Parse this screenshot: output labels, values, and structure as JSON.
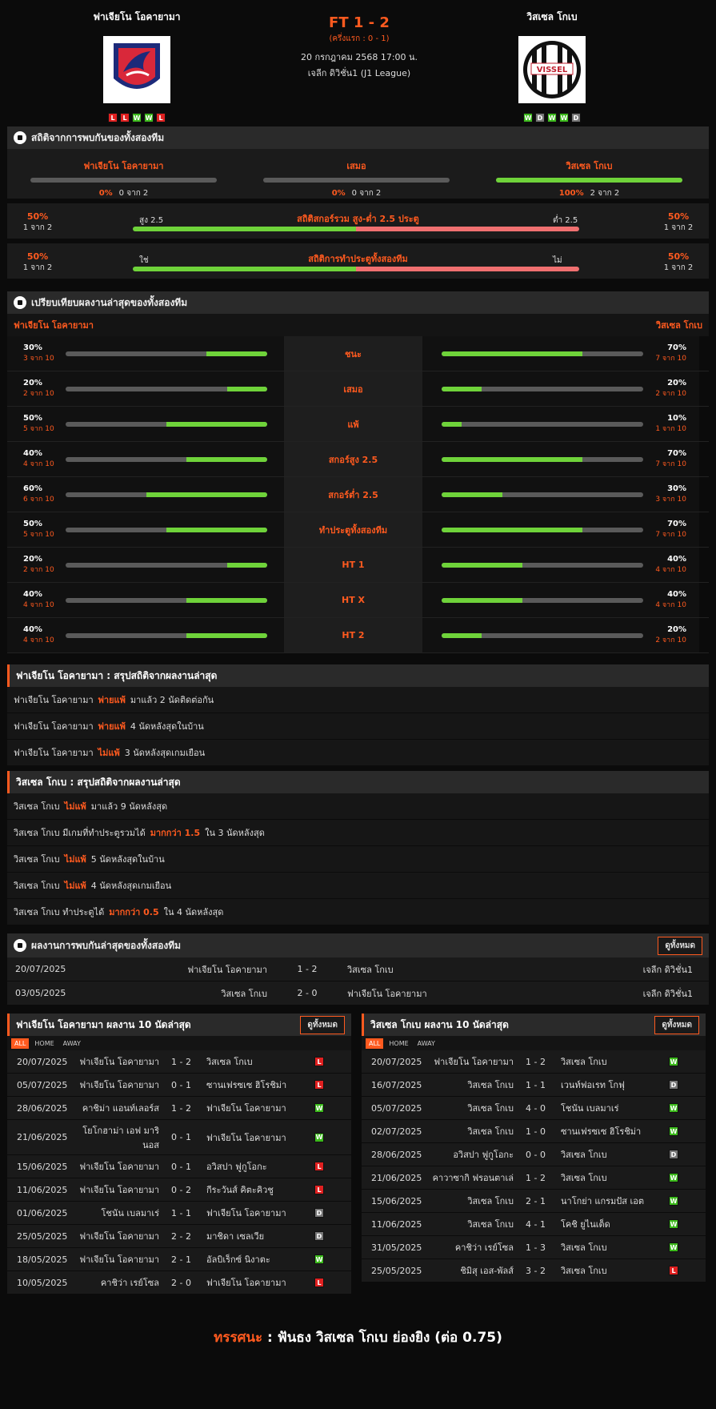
{
  "header": {
    "home": "ฟาเจียโน โอคายามา",
    "away": "วิสเซล โกเบ",
    "score": "FT 1 - 2",
    "half": "(ครึ่งแรก : 0 - 1)",
    "date": "20 กรกฎาคม 2568 17:00 น.",
    "league": "เจลีก ดิวิชั่น1 (J1 League)",
    "home_form": [
      "L",
      "L",
      "W",
      "W",
      "L"
    ],
    "away_form": [
      "W",
      "D",
      "W",
      "W",
      "D"
    ],
    "away_logo_text": "VISSEL"
  },
  "h2h": {
    "title": "สถิติจากการพบกันของทั้งสองทีม",
    "cols": [
      {
        "name": "ฟาเจียโน โอคายามา",
        "pct": "0%",
        "of": "0 จาก 2",
        "value": 0
      },
      {
        "name": "เสมอ",
        "pct": "0%",
        "of": "0 จาก 2",
        "value": 0
      },
      {
        "name": "วิสเซล โกเบ",
        "pct": "100%",
        "of": "2 จาก 2",
        "value": 100
      }
    ],
    "ou": {
      "title": "สถิติสกอร์รวม สูง-ต่ำ 2.5 ประตู",
      "left_label": "สูง 2.5",
      "right_label": "ต่ำ 2.5",
      "left_pct": "50%",
      "left_of": "1 จาก 2",
      "right_pct": "50%",
      "right_of": "1 จาก 2",
      "value": 50
    },
    "btts": {
      "title": "สถิติการทำประตูทั้งสองทีม",
      "left_label": "ใช่",
      "right_label": "ไม่",
      "left_pct": "50%",
      "left_of": "1 จาก 2",
      "right_pct": "50%",
      "right_of": "1 จาก 2",
      "value": 50
    }
  },
  "compare": {
    "title": "เปรียบเทียบผลงานล่าสุดของทั้งสองทีม",
    "home": "ฟาเจียโน โอคายามา",
    "away": "วิสเซล โกเบ",
    "rows": [
      {
        "label": "ชนะ",
        "hp": "30%",
        "hof": "3 จาก 10",
        "hv": 30,
        "ap": "70%",
        "aof": "7 จาก 10",
        "av": 70
      },
      {
        "label": "เสมอ",
        "hp": "20%",
        "hof": "2 จาก 10",
        "hv": 20,
        "ap": "20%",
        "aof": "2 จาก 10",
        "av": 20
      },
      {
        "label": "แพ้",
        "hp": "50%",
        "hof": "5 จาก 10",
        "hv": 50,
        "ap": "10%",
        "aof": "1 จาก 10",
        "av": 10
      },
      {
        "label": "สกอร์สูง 2.5",
        "hp": "40%",
        "hof": "4 จาก 10",
        "hv": 40,
        "ap": "70%",
        "aof": "7 จาก 10",
        "av": 70
      },
      {
        "label": "สกอร์ต่ำ 2.5",
        "hp": "60%",
        "hof": "6 จาก 10",
        "hv": 60,
        "ap": "30%",
        "aof": "3 จาก 10",
        "av": 30
      },
      {
        "label": "ทำประตูทั้งสองทีม",
        "hp": "50%",
        "hof": "5 จาก 10",
        "hv": 50,
        "ap": "70%",
        "aof": "7 จาก 10",
        "av": 70
      },
      {
        "label": "HT 1",
        "hp": "20%",
        "hof": "2 จาก 10",
        "hv": 20,
        "ap": "40%",
        "aof": "4 จาก 10",
        "av": 40
      },
      {
        "label": "HT X",
        "hp": "40%",
        "hof": "4 จาก 10",
        "hv": 40,
        "ap": "40%",
        "aof": "4 จาก 10",
        "av": 40
      },
      {
        "label": "HT 2",
        "hp": "40%",
        "hof": "4 จาก 10",
        "hv": 40,
        "ap": "20%",
        "aof": "2 จาก 10",
        "av": 20
      }
    ]
  },
  "home_summary": {
    "title": "ฟาเจียโน โอคายามา : สรุปสถิติจากผลงานล่าสุด",
    "rows": [
      {
        "pre": "ฟาเจียโน โอคายามา",
        "hl": "พ่ายแพ้",
        "post": "มาแล้ว 2 นัดติดต่อกัน"
      },
      {
        "pre": "ฟาเจียโน โอคายามา",
        "hl": "พ่ายแพ้",
        "post": "4 นัดหลังสุดในบ้าน"
      },
      {
        "pre": "ฟาเจียโน โอคายามา",
        "hl": "ไม่แพ้",
        "post": "3 นัดหลังสุดเกมเยือน"
      }
    ]
  },
  "away_summary": {
    "title": "วิสเซล โกเบ : สรุปสถิติจากผลงานล่าสุด",
    "rows": [
      {
        "pre": "วิสเซล โกเบ",
        "hl": "ไม่แพ้",
        "post": "มาแล้ว 9 นัดหลังสุด"
      },
      {
        "pre": "วิสเซล โกเบ มีเกมที่ทำประตูรวมได้",
        "hl": "มากกว่า 1.5",
        "post": "ใน 3 นัดหลังสุด"
      },
      {
        "pre": "วิสเซล โกเบ",
        "hl": "ไม่แพ้",
        "post": "5 นัดหลังสุดในบ้าน"
      },
      {
        "pre": "วิสเซล โกเบ",
        "hl": "ไม่แพ้",
        "post": "4 นัดหลังสุดเกมเยือน"
      },
      {
        "pre": "วิสเซล โกเบ ทำประตูได้",
        "hl": "มากกว่า 0.5",
        "post": "ใน 4 นัดหลังสุด"
      }
    ]
  },
  "recent_h2h": {
    "title": "ผลงานการพบกันล่าสุดของทั้งสองทีม",
    "see_all": "ดูทั้งหมด",
    "rows": [
      {
        "date": "20/07/2025",
        "home": "ฟาเจียโน โอคายามา",
        "score": "1 - 2",
        "away": "วิสเซล โกเบ",
        "league": "เจลีก ดิวิชั่น1"
      },
      {
        "date": "03/05/2025",
        "home": "วิสเซล โกเบ",
        "score": "2 - 0",
        "away": "ฟาเจียโน โอคายามา",
        "league": "เจลีก ดิวิชั่น1"
      }
    ]
  },
  "tabs": [
    "ALL",
    "HOME",
    "AWAY"
  ],
  "home_last10": {
    "title": "ฟาเจียโน โอคายามา ผลงาน 10 นัดล่าสุด",
    "see_all": "ดูทั้งหมด",
    "rows": [
      {
        "date": "20/07/2025",
        "home": "ฟาเจียโน โอคายามา",
        "score": "1 - 2",
        "away": "วิสเซล โกเบ",
        "res": "L"
      },
      {
        "date": "05/07/2025",
        "home": "ฟาเจียโน โอคายามา",
        "score": "0 - 1",
        "away": "ซานเฟรซเซ ฮิโรชิม่า",
        "res": "L"
      },
      {
        "date": "28/06/2025",
        "home": "คาชิม่า แอนท์เลอร์ส",
        "score": "1 - 2",
        "away": "ฟาเจียโน โอคายามา",
        "res": "W"
      },
      {
        "date": "21/06/2025",
        "home": "โยโกฮาม่า เอฟ มาริ นอส",
        "score": "0 - 1",
        "away": "ฟาเจียโน โอคายามา",
        "res": "W",
        "tall": true
      },
      {
        "date": "15/06/2025",
        "home": "ฟาเจียโน โอคายามา",
        "score": "0 - 1",
        "away": "อวิสปา ฟูกูโอกะ",
        "res": "L"
      },
      {
        "date": "11/06/2025",
        "home": "ฟาเจียโน โอคายามา",
        "score": "0 - 2",
        "away": "กีระวันส์ คิตะคิวชู",
        "res": "L"
      },
      {
        "date": "01/06/2025",
        "home": "โชนัน เบลมาเร่",
        "score": "1 - 1",
        "away": "ฟาเจียโน โอคายามา",
        "res": "D"
      },
      {
        "date": "25/05/2025",
        "home": "ฟาเจียโน โอคายามา",
        "score": "2 - 2",
        "away": "มาชิดา เซลเวีย",
        "res": "D"
      },
      {
        "date": "18/05/2025",
        "home": "ฟาเจียโน โอคายามา",
        "score": "2 - 1",
        "away": "อัลบิเร็กซ์ นิงาตะ",
        "res": "W"
      },
      {
        "date": "10/05/2025",
        "home": "คาชิว่า เรย์โซล",
        "score": "2 - 0",
        "away": "ฟาเจียโน โอคายามา",
        "res": "L"
      }
    ]
  },
  "away_last10": {
    "title": "วิสเซล โกเบ ผลงาน 10 นัดล่าสุด",
    "see_all": "ดูทั้งหมด",
    "rows": [
      {
        "date": "20/07/2025",
        "home": "ฟาเจียโน โอคายามา",
        "score": "1 - 2",
        "away": "วิสเซล โกเบ",
        "res": "W"
      },
      {
        "date": "16/07/2025",
        "home": "วิสเซล โกเบ",
        "score": "1 - 1",
        "away": "เวนท์ฟอเรท โกฟุ",
        "res": "D"
      },
      {
        "date": "05/07/2025",
        "home": "วิสเซล โกเบ",
        "score": "4 - 0",
        "away": "โชนัน เบลมาเร่",
        "res": "W"
      },
      {
        "date": "02/07/2025",
        "home": "วิสเซล โกเบ",
        "score": "1 - 0",
        "away": "ซานเฟรซเซ ฮิโรชิม่า",
        "res": "W"
      },
      {
        "date": "28/06/2025",
        "home": "อวิสปา ฟูกูโอกะ",
        "score": "0 - 0",
        "away": "วิสเซล โกเบ",
        "res": "D"
      },
      {
        "date": "21/06/2025",
        "home": "คาวาซากิ ฟรอนตาเล่",
        "score": "1 - 2",
        "away": "วิสเซล โกเบ",
        "res": "W"
      },
      {
        "date": "15/06/2025",
        "home": "วิสเซล โกเบ",
        "score": "2 - 1",
        "away": "นาโกย่า แกรมปัส เอต",
        "res": "W"
      },
      {
        "date": "11/06/2025",
        "home": "วิสเซล โกเบ",
        "score": "4 - 1",
        "away": "โคชิ ยูไนเต็ด",
        "res": "W"
      },
      {
        "date": "31/05/2025",
        "home": "คาชิว่า เรย์โซล",
        "score": "1 - 3",
        "away": "วิสเซล โกเบ",
        "res": "W"
      },
      {
        "date": "25/05/2025",
        "home": "ชิมิสุ เอส-พัลส์",
        "score": "3 - 2",
        "away": "วิสเซล โกเบ",
        "res": "L"
      }
    ]
  },
  "verdict": {
    "label": "ทรรศนะ",
    "sep": " : ",
    "text": "ฟันธง วิสเซล โกเบ ย่องยิง (ต่อ 0.75)"
  },
  "colors": {
    "accent": "#ff5a1f",
    "green": "#6fd33a",
    "red": "#f07070",
    "win": "#3cba1c",
    "loss": "#e02020",
    "draw": "#777777"
  }
}
